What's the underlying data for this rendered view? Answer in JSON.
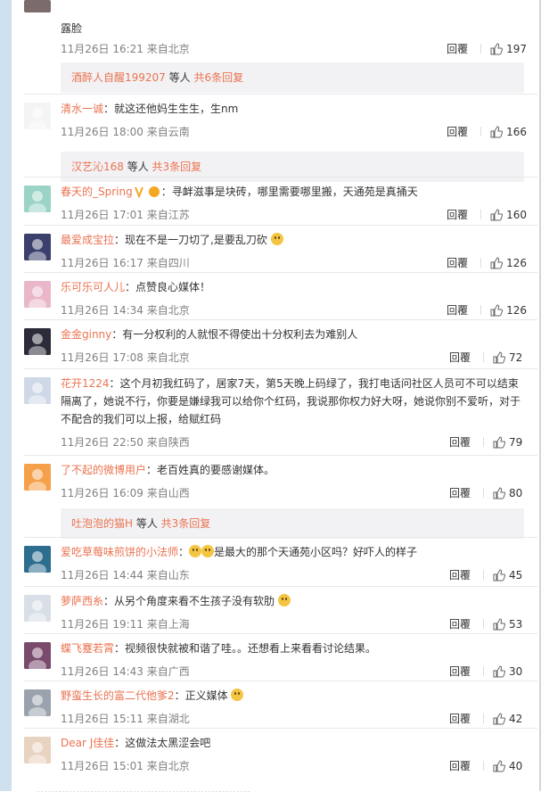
{
  "top_partial": {
    "text_tail": "露脸",
    "time": "11月26日 16:21 来自北京",
    "likes": "197",
    "reply_label": "回覆",
    "sub": {
      "who": "酒醉人自醒199207",
      "mid": " 等人 ",
      "more": "共6条回复"
    }
  },
  "comments": [
    {
      "user": "清水一诚",
      "text": "：就这还他妈生生生，生nm",
      "time": "11月26日 18:00 来自云南",
      "likes": "166",
      "avatar": "avatar-cartoon",
      "avatar_color": "#f4f4f4",
      "sub": {
        "who": "汉艺沁168",
        "mid": " 等人 ",
        "more": "共3条回复"
      }
    },
    {
      "user": "春天的_Spring",
      "text": "：寻衅滋事是块砖，哪里需要哪里搬，天通苑是真捅天",
      "time": "11月26日 17:01 来自江苏",
      "likes": "160",
      "avatar": "avatar-girl",
      "avatar_color": "#9bd3c6"
    },
    {
      "user": "最爱成宝拉",
      "text": "：现在不是一刀切了,是要乱刀砍",
      "time": "11月26日 16:17 来自四川",
      "likes": "126",
      "avatar": "avatar-dark",
      "avatar_color": "#3a3f6b"
    },
    {
      "user": "乐可乐可人儿",
      "text": "：点赞良心媒体！",
      "time": "11月26日 14:34 来自北京",
      "likes": "126",
      "avatar": "avatar-flower",
      "avatar_color": "#e9b7c9"
    },
    {
      "user": "金金ginny",
      "text": "：有一分权利的人就恨不得使出十分权利去为难别人",
      "time": "11月26日 17:08 来自北京",
      "likes": "72",
      "avatar": "avatar-anime",
      "avatar_color": "#2b2b3a"
    },
    {
      "user": "花开1224",
      "text": "：这个月初我红码了，居家7天，第5天晚上码绿了，我打电话问社区人员可不可以结束隔离了，她说不行，你要是嫌绿我可以给你个红码，我说那你权力好大呀，她说你别不爱听，对于不配合的我们可以上报，给赋红码",
      "time": "11月26日 22:50 来自陕西",
      "likes": "79",
      "avatar": "avatar-boy",
      "avatar_color": "#cfd8e6"
    },
    {
      "user": "了不起的微博用户",
      "text": "：老百姓真的要感谢媒体。",
      "time": "11月26日 16:09 来自山西",
      "likes": "80",
      "avatar": "avatar-bear",
      "avatar_color": "#f5a04a",
      "sub": {
        "who": "吐泡泡的猫H",
        "mid": " 等人 ",
        "more": "共3条回复"
      }
    },
    {
      "user": "爱吃草莓味煎饼的小法师",
      "text": "是最大的那个天通苑小区吗？好吓人的样子",
      "time": "11月26日 14:44 来自山东",
      "likes": "45",
      "avatar": "avatar-sea",
      "avatar_color": "#2d6d8f"
    },
    {
      "user": "萝萨西糸",
      "text": "：从另个角度来看不生孩子没有软肋",
      "time": "11月26日 19:11 来自上海",
      "likes": "53",
      "avatar": "avatar-bike",
      "avatar_color": "#d8dfe6"
    },
    {
      "user": "蝶飞蹇若霄",
      "text": "：视频很快就被和谐了哇。。还想看上来看看讨论结果。",
      "time": "11月26日 14:43 来自广西",
      "likes": "30",
      "avatar": "avatar-doll",
      "avatar_color": "#7a4a6d"
    },
    {
      "user": "野蛮生长的富二代他爹2",
      "text": "：正义媒体",
      "time": "11月26日 15:11 来自湖北",
      "likes": "42",
      "avatar": "avatar-cat",
      "avatar_color": "#9aa3ad"
    },
    {
      "user": "Dear J佳佳",
      "text": "：这做法太黑涩会吧",
      "time": "11月26日 15:01 来自北京",
      "likes": "40",
      "avatar": "avatar-woman",
      "avatar_color": "#e8d2c0"
    }
  ],
  "reply_label": "回覆",
  "colors": {
    "accent": "#eb7350",
    "meta": "#808080",
    "sub_bg": "#f2f2f5",
    "strip": "#cfe0ef"
  }
}
